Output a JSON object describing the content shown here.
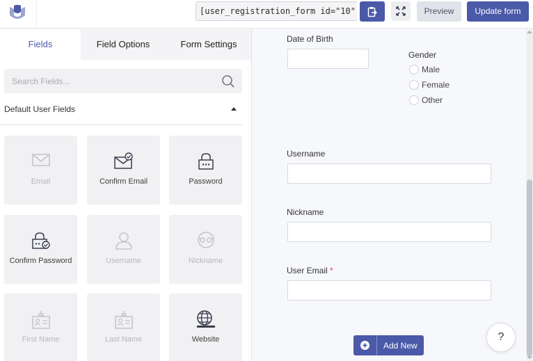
{
  "toolbar": {
    "shortcode": "[user_registration_form id=\"10\"]",
    "preview_label": "Preview",
    "update_label": "Update form"
  },
  "tabs": [
    {
      "label": "Fields",
      "active": true
    },
    {
      "label": "Field Options",
      "active": false
    },
    {
      "label": "Form Settings",
      "active": false
    }
  ],
  "search": {
    "placeholder": "Search Fields..."
  },
  "section": {
    "title": "Default User Fields"
  },
  "fields": [
    {
      "label": "Email",
      "icon": "envelope-icon",
      "disabled": true
    },
    {
      "label": "Confirm Email",
      "icon": "envelope-check-icon",
      "disabled": false
    },
    {
      "label": "Password",
      "icon": "lock-icon",
      "disabled": false
    },
    {
      "label": "Confirm Password",
      "icon": "lock-check-icon",
      "disabled": false
    },
    {
      "label": "Username",
      "icon": "user-icon",
      "disabled": true
    },
    {
      "label": "Nickname",
      "icon": "mask-icon",
      "disabled": true
    },
    {
      "label": "First Name",
      "icon": "id-card-icon",
      "disabled": true
    },
    {
      "label": "Last Name",
      "icon": "id-card-icon",
      "disabled": true
    },
    {
      "label": "Website",
      "icon": "globe-icon",
      "disabled": false
    }
  ],
  "form": {
    "dob_label": "Date of Birth",
    "gender_label": "Gender",
    "gender_options": [
      "Male",
      "Female",
      "Other"
    ],
    "username_label": "Username",
    "nickname_label": "Nickname",
    "email_label": "User Email",
    "required_mark": "*",
    "add_new_label": "Add New"
  },
  "help": {
    "label": "?"
  },
  "colors": {
    "accent": "#4a59a8",
    "required": "#d94040"
  }
}
